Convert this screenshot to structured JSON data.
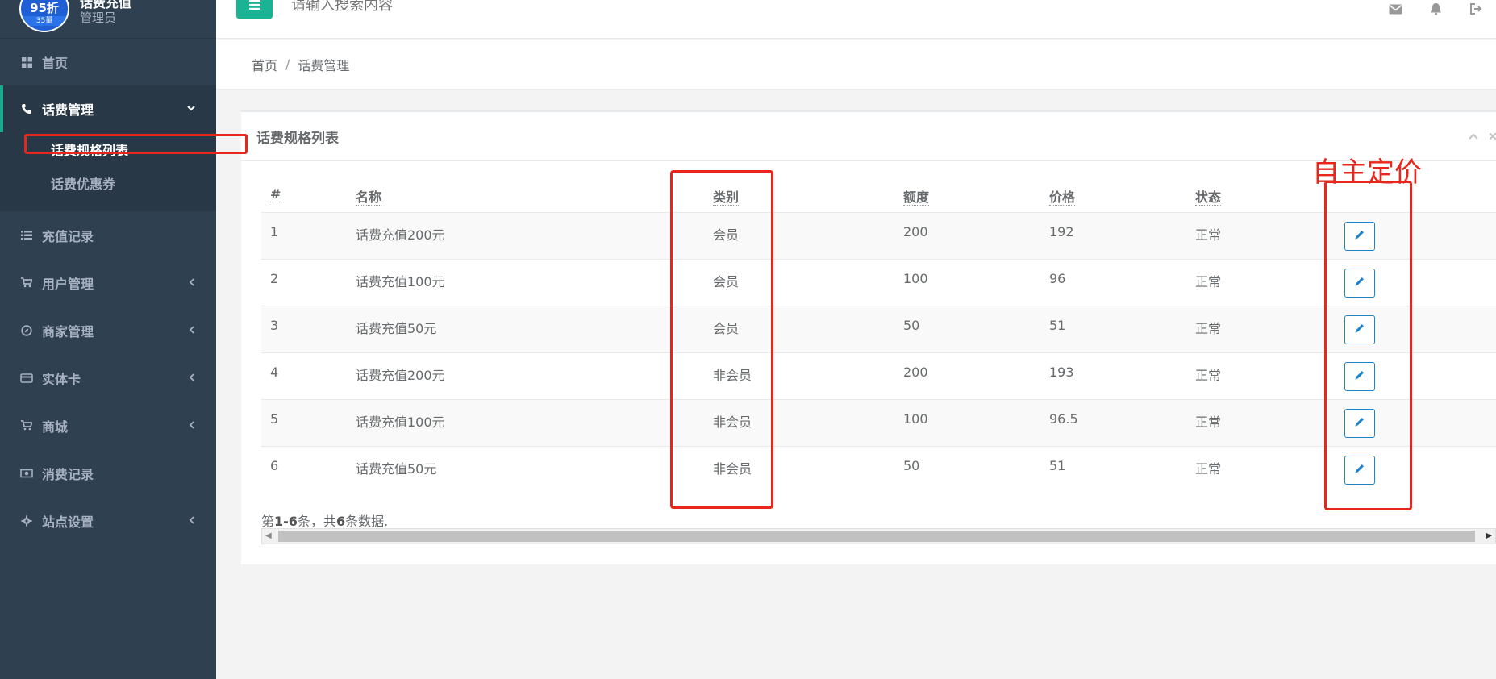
{
  "sidebar": {
    "avatar": {
      "big": "95折",
      "small": "35量"
    },
    "profile_name": "话费充值",
    "profile_role": "管理员",
    "items": [
      {
        "label": "首页",
        "icon": "dashboard-icon"
      },
      {
        "label": "话费管理",
        "icon": "phone-icon"
      },
      {
        "label": "充值记录",
        "icon": "list-icon"
      },
      {
        "label": "用户管理",
        "icon": "cart-icon"
      },
      {
        "label": "商家管理",
        "icon": "compass-icon"
      },
      {
        "label": "实体卡",
        "icon": "credit-card-icon"
      },
      {
        "label": "商城",
        "icon": "cart-icon"
      },
      {
        "label": "消费记录",
        "icon": "money-icon"
      },
      {
        "label": "站点设置",
        "icon": "gear-icon"
      }
    ],
    "submenu": [
      {
        "label": "话费规格列表"
      },
      {
        "label": "话费优惠券"
      }
    ]
  },
  "topbar": {
    "search_placeholder": "请输入搜索内容",
    "icons": [
      "envelope-icon",
      "bell-icon",
      "signout-icon"
    ]
  },
  "breadcrumb": {
    "home": "首页",
    "separator": "/",
    "current": "话费管理"
  },
  "panel": {
    "title": "话费规格列表",
    "table": {
      "headers": [
        "#",
        "名称",
        "类别",
        "额度",
        "价格",
        "状态",
        ""
      ],
      "rows": [
        [
          "1",
          "话费充值200元",
          "会员",
          "200",
          "192",
          "正常"
        ],
        [
          "2",
          "话费充值100元",
          "会员",
          "100",
          "96",
          "正常"
        ],
        [
          "3",
          "话费充值50元",
          "会员",
          "50",
          "51",
          "正常"
        ],
        [
          "4",
          "话费充值200元",
          "非会员",
          "200",
          "193",
          "正常"
        ],
        [
          "5",
          "话费充值100元",
          "非会员",
          "100",
          "96.5",
          "正常"
        ],
        [
          "6",
          "话费充值50元",
          "非会员",
          "50",
          "51",
          "正常"
        ]
      ]
    },
    "summary": {
      "prefix": "第",
      "range": "1-6",
      "middle": "条，共",
      "total": "6",
      "suffix": "条数据."
    }
  },
  "annotation": {
    "label": "自主定价",
    "color": "#e8261c"
  },
  "colors": {
    "sidebar_bg": "#2f4050",
    "accent": "#1ab394",
    "edit_button": "#1c84c6"
  }
}
